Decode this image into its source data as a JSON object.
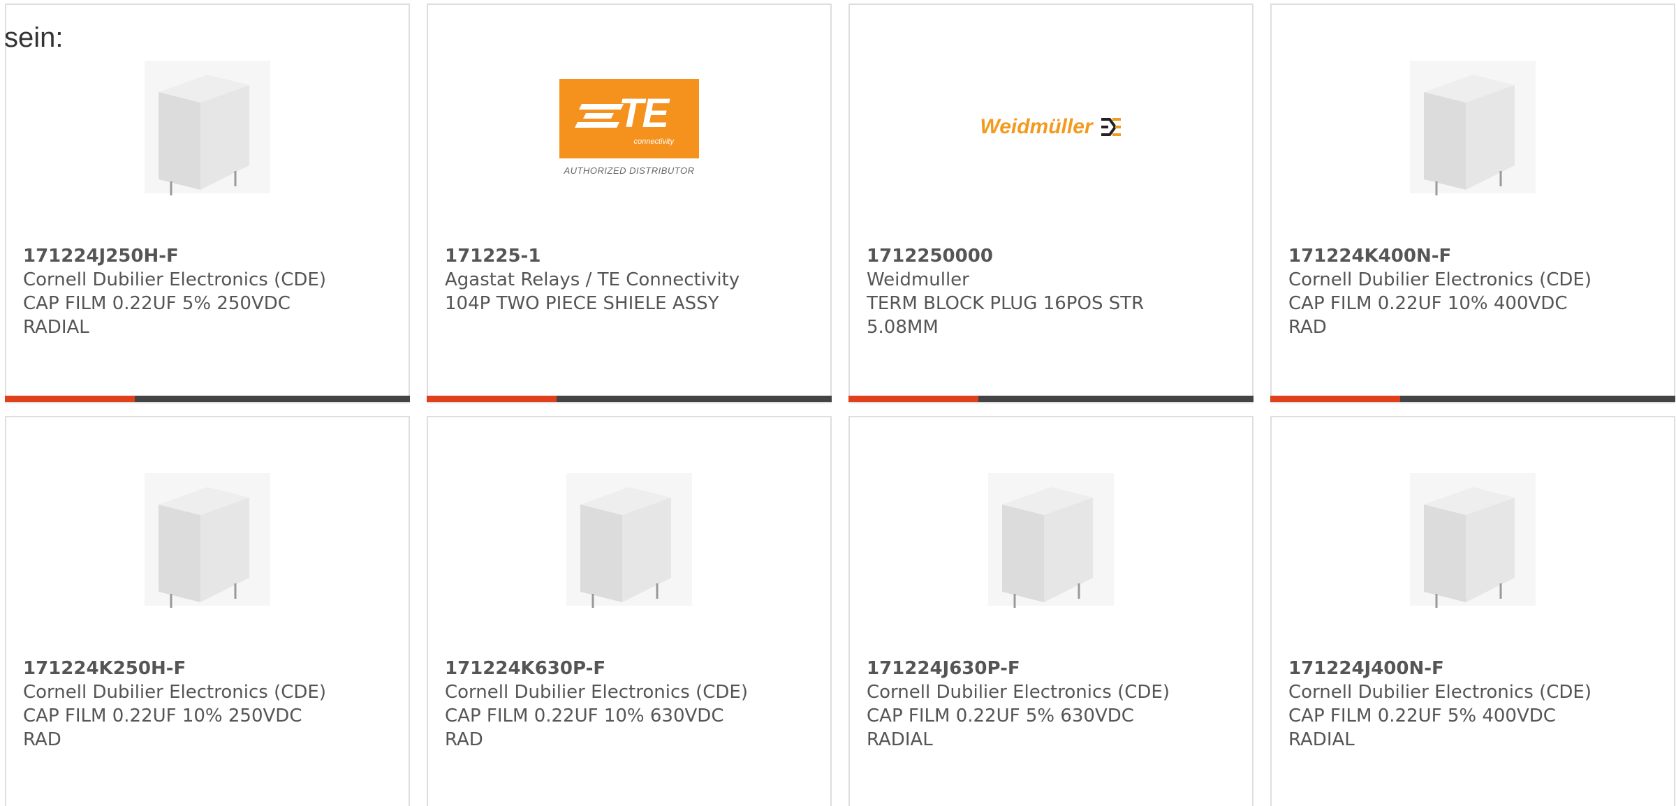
{
  "intro_text": "sein:",
  "accent_color": "#e0401c",
  "bar_color": "#444444",
  "products": [
    {
      "part_number": "171224J250H-F",
      "manufacturer": "Cornell Dubilier Electronics (CDE)",
      "description": "CAP FILM 0.22UF 5% 250VDC RADIAL",
      "image": "film-capacitor"
    },
    {
      "part_number": "171225-1",
      "manufacturer": "Agastat Relays / TE Connectivity",
      "description": "104P TWO PIECE SHIELE ASSY",
      "image": "te-connectivity-logo",
      "logo_text": "TE",
      "logo_sub": "connectivity",
      "logo_caption": "AUTHORIZED DISTRIBUTOR"
    },
    {
      "part_number": "1712250000",
      "manufacturer": "Weidmuller",
      "description": "TERM BLOCK PLUG 16POS STR 5.08MM",
      "image": "weidmuller-logo",
      "logo_text": "Weidmüller"
    },
    {
      "part_number": "171224K400N-F",
      "manufacturer": "Cornell Dubilier Electronics (CDE)",
      "description": "CAP FILM 0.22UF 10% 400VDC RAD",
      "image": "film-capacitor"
    },
    {
      "part_number": "171224K250H-F",
      "manufacturer": "Cornell Dubilier Electronics (CDE)",
      "description": "CAP FILM 0.22UF 10% 250VDC RAD",
      "image": "film-capacitor"
    },
    {
      "part_number": "171224K630P-F",
      "manufacturer": "Cornell Dubilier Electronics (CDE)",
      "description": "CAP FILM 0.22UF 10% 630VDC RAD",
      "image": "film-capacitor"
    },
    {
      "part_number": "171224J630P-F",
      "manufacturer": "Cornell Dubilier Electronics (CDE)",
      "description": "CAP FILM 0.22UF 5% 630VDC RADIAL",
      "image": "film-capacitor"
    },
    {
      "part_number": "171224J400N-F",
      "manufacturer": "Cornell Dubilier Electronics (CDE)",
      "description": "CAP FILM 0.22UF 5% 400VDC RADIAL",
      "image": "film-capacitor"
    }
  ],
  "progress_fraction": 0.32
}
